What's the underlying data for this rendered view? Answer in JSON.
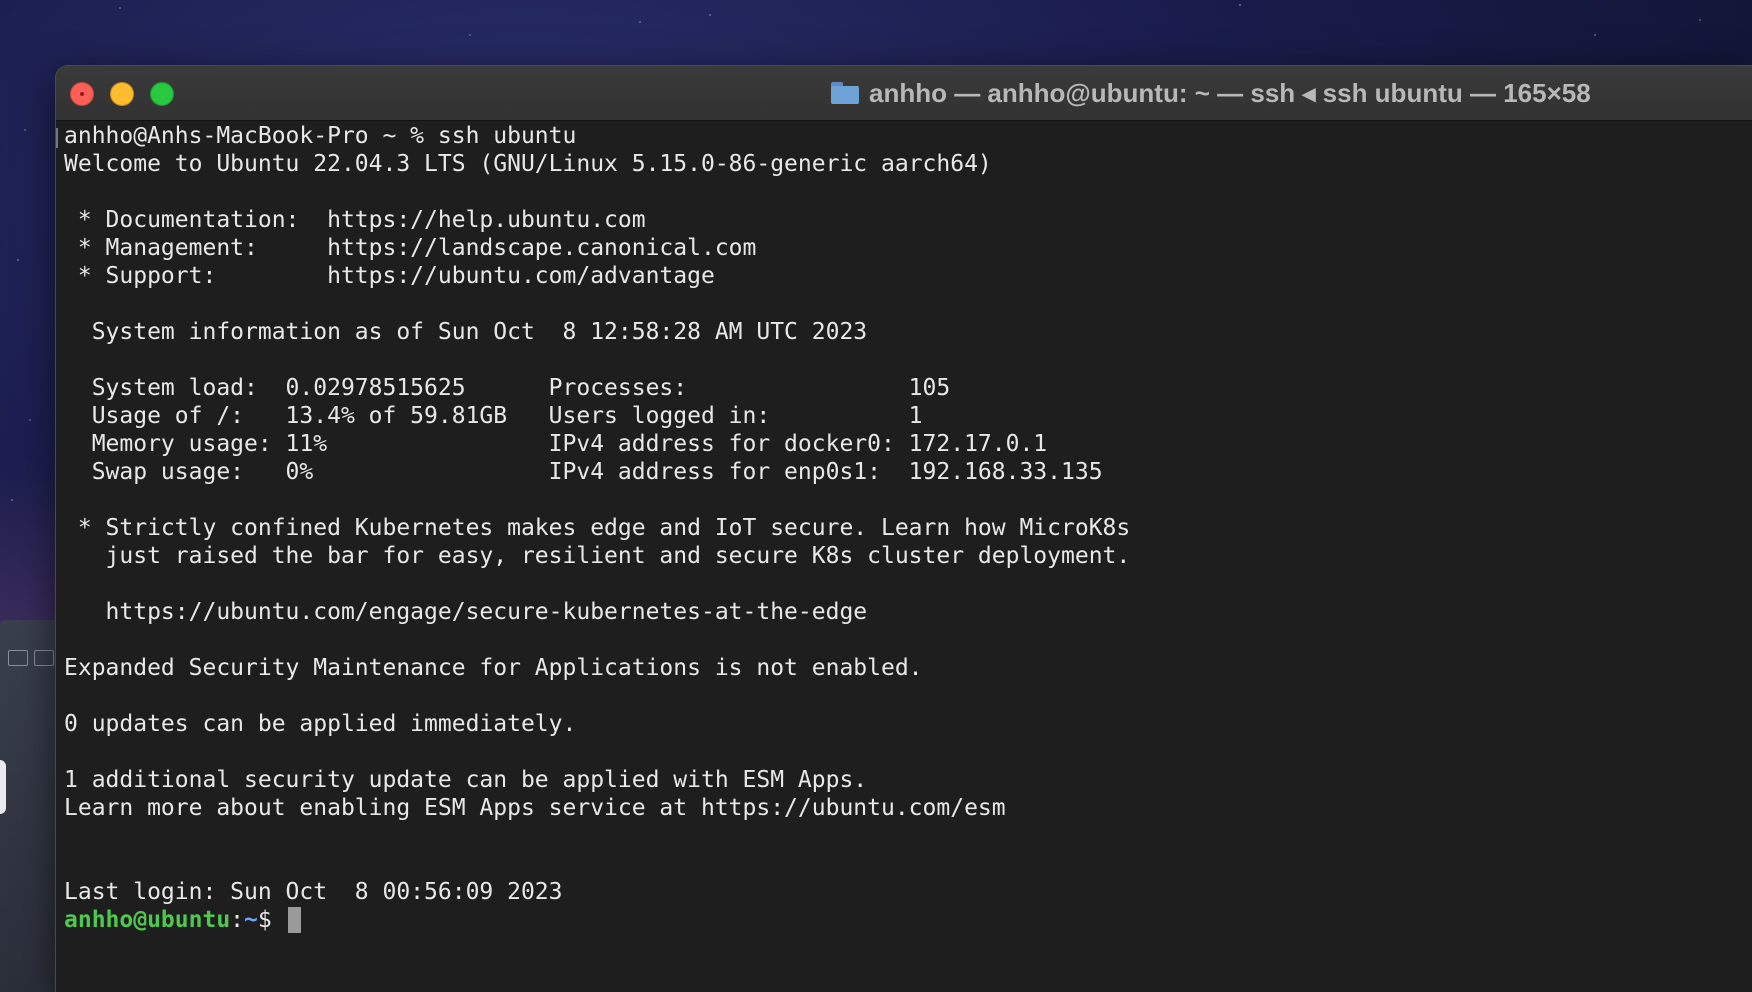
{
  "window": {
    "title": "anhho — anhho@ubuntu: ~ — ssh ◂ ssh ubuntu — 165×58"
  },
  "colors": {
    "terminal_bg": "#1e1e1e",
    "text": "#e8e8e8",
    "prompt_user": "#4ec84e",
    "prompt_path": "#6aa3ff",
    "close": "#fe5f57",
    "minimize": "#febc2e",
    "maximize": "#28c840"
  },
  "terminal": {
    "lines": [
      "anhho@Anhs-MacBook-Pro ~ % ssh ubuntu",
      "Welcome to Ubuntu 22.04.3 LTS (GNU/Linux 5.15.0-86-generic aarch64)",
      "",
      " * Documentation:  https://help.ubuntu.com",
      " * Management:     https://landscape.canonical.com",
      " * Support:        https://ubuntu.com/advantage",
      "",
      "  System information as of Sun Oct  8 12:58:28 AM UTC 2023",
      "",
      "  System load:  0.02978515625      Processes:                105",
      "  Usage of /:   13.4% of 59.81GB   Users logged in:          1",
      "  Memory usage: 11%                IPv4 address for docker0: 172.17.0.1",
      "  Swap usage:   0%                 IPv4 address for enp0s1:  192.168.33.135",
      "",
      " * Strictly confined Kubernetes makes edge and IoT secure. Learn how MicroK8s",
      "   just raised the bar for easy, resilient and secure K8s cluster deployment.",
      "",
      "   https://ubuntu.com/engage/secure-kubernetes-at-the-edge",
      "",
      "Expanded Security Maintenance for Applications is not enabled.",
      "",
      "0 updates can be applied immediately.",
      "",
      "1 additional security update can be applied with ESM Apps.",
      "Learn more about enabling ESM Apps service at https://ubuntu.com/esm",
      "",
      "",
      "Last login: Sun Oct  8 00:56:09 2023"
    ],
    "prompt": {
      "user_host": "anhho@ubuntu",
      "separator": ":",
      "path": "~",
      "symbol": "$ "
    }
  }
}
